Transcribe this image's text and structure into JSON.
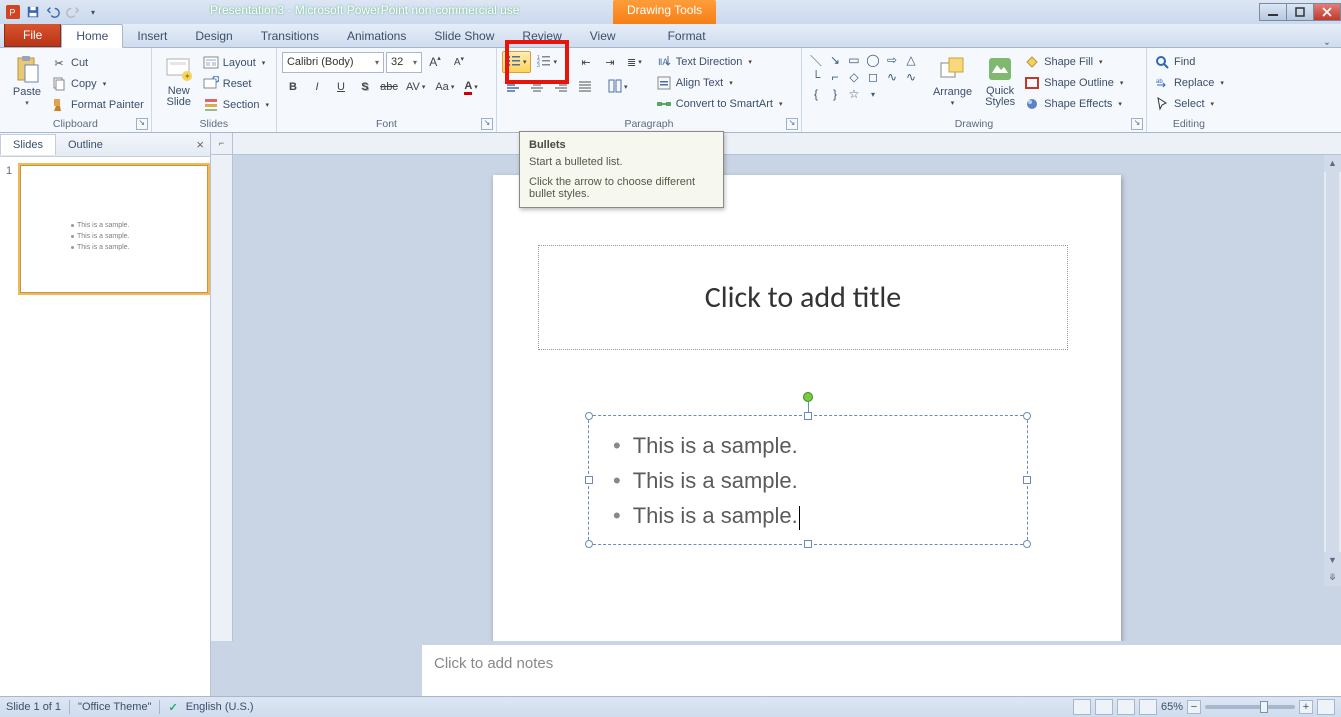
{
  "title": "Presentation3  -  Microsoft PowerPoint non-commercial use",
  "context_tab": "Drawing Tools",
  "tabs": {
    "file": "File",
    "home": "Home",
    "insert": "Insert",
    "design": "Design",
    "transitions": "Transitions",
    "animations": "Animations",
    "slideshow": "Slide Show",
    "review": "Review",
    "view": "View",
    "format": "Format"
  },
  "groups": {
    "clipboard": "Clipboard",
    "slides": "Slides",
    "font": "Font",
    "paragraph": "Paragraph",
    "drawing": "Drawing",
    "editing": "Editing"
  },
  "clipboard": {
    "paste": "Paste",
    "cut": "Cut",
    "copy": "Copy",
    "format_painter": "Format Painter"
  },
  "slides": {
    "new_slide": "New\nSlide",
    "layout": "Layout",
    "reset": "Reset",
    "section": "Section"
  },
  "font": {
    "name": "Calibri (Body)",
    "size": "32"
  },
  "paragraph": {
    "text_direction": "Text Direction",
    "align_text": "Align Text",
    "smartart": "Convert to SmartArt"
  },
  "drawing": {
    "arrange": "Arrange",
    "quick_styles": "Quick\nStyles",
    "shape_fill": "Shape Fill",
    "shape_outline": "Shape Outline",
    "shape_effects": "Shape Effects"
  },
  "editing": {
    "find": "Find",
    "replace": "Replace",
    "select": "Select"
  },
  "tooltip": {
    "title": "Bullets",
    "line1": "Start a bulleted list.",
    "line2": "Click the arrow to choose different bullet styles."
  },
  "pane_tabs": {
    "slides": "Slides",
    "outline": "Outline"
  },
  "thumb_num": "1",
  "thumb_lines": {
    "a": "This is a sample.",
    "b": "This is a sample.",
    "c": "This is a sample."
  },
  "title_placeholder": "Click to add title",
  "body_lines": {
    "a": "This is a sample.",
    "b": "This is a sample.",
    "c": "This is a sample."
  },
  "notes_placeholder": "Click to add notes",
  "status": {
    "slide": "Slide 1 of 1",
    "theme": "\"Office Theme\"",
    "lang": "English (U.S.)",
    "zoom": "65%"
  }
}
